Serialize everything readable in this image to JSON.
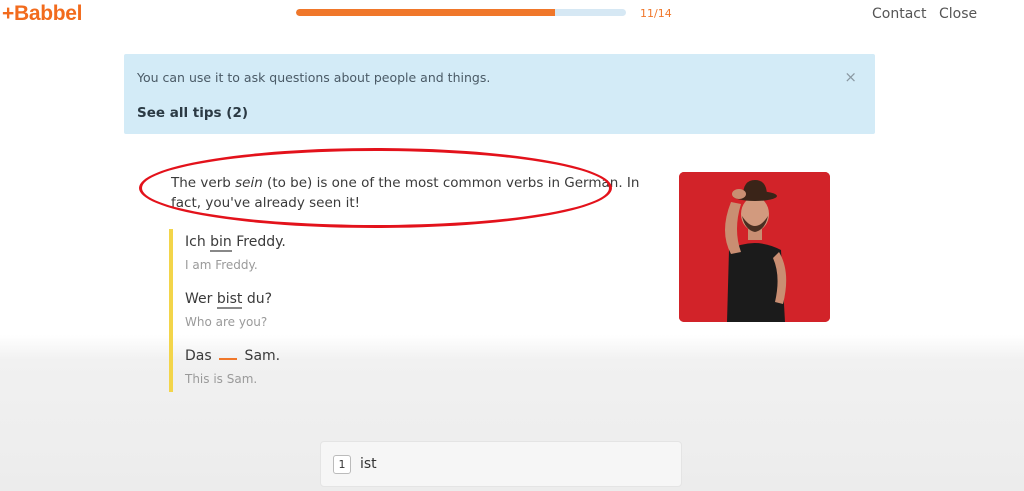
{
  "app": {
    "logo": "+Babbel"
  },
  "header": {
    "progress": {
      "fraction": 0.7857,
      "label": "11/14"
    },
    "contact_label": "Contact",
    "close_label": "Close"
  },
  "tip": {
    "text": "You can use it to ask questions about people and things.",
    "link_label": "See all tips (2)",
    "close_icon": "×"
  },
  "intro": {
    "prefix": "The verb ",
    "verb": "sein",
    "suffix": " (to be) is one of the most common verbs in German. In fact, you've already seen it!"
  },
  "examples": [
    {
      "before": "Ich ",
      "highlight": "bin",
      "after": " Freddy.",
      "translation": "I am Freddy."
    },
    {
      "before": "Wer ",
      "highlight": "bist",
      "after": " du?",
      "translation": "Who are you?"
    },
    {
      "before": "Das ",
      "highlight": "",
      "after": " Sam.",
      "translation": "This is Sam."
    }
  ],
  "answer": {
    "key": "1",
    "word": "ist"
  },
  "colors": {
    "brand": "#f26b1d",
    "tip_bg": "#d3ebf7",
    "annotation": "#e3121b",
    "accent_bar": "#f3d54a"
  }
}
